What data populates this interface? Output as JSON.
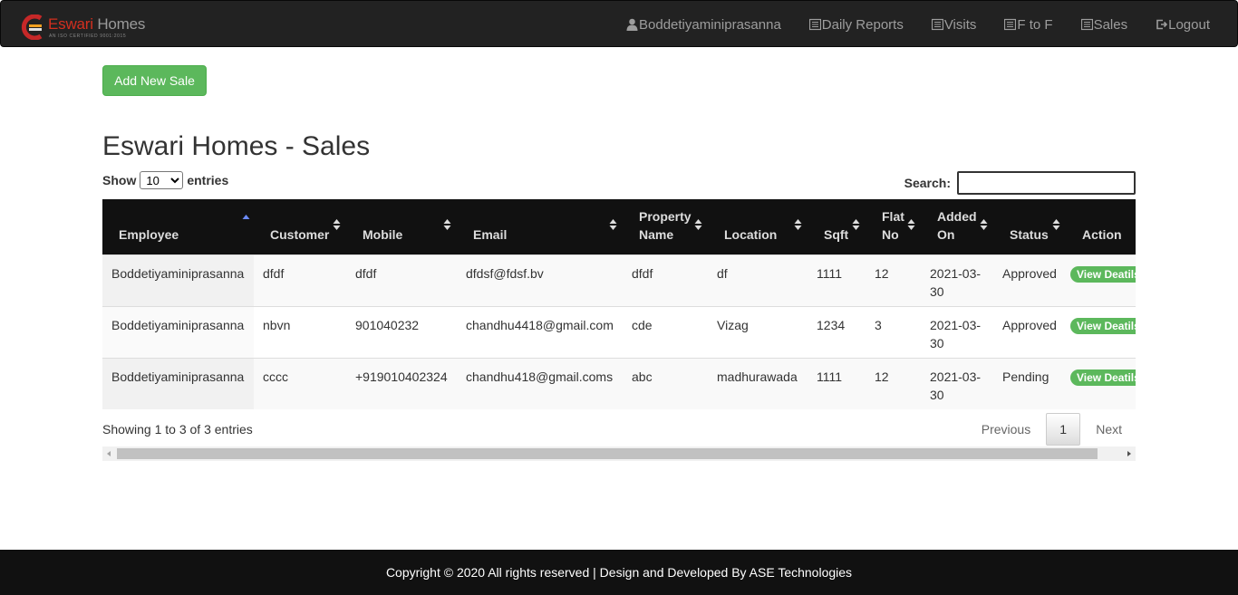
{
  "brand": {
    "name_part1": "Eswari",
    "name_part2": "Homes",
    "tagline": "AN ISO CERTIFIED 9001:2015",
    "accent_color": "#d32f1f"
  },
  "nav": [
    {
      "label": "Boddetiyaminiprasanna",
      "icon": "user-icon"
    },
    {
      "label": "Daily Reports",
      "icon": "list-icon"
    },
    {
      "label": "Visits",
      "icon": "list-icon"
    },
    {
      "label": "F to F",
      "icon": "list-icon"
    },
    {
      "label": "Sales",
      "icon": "list-icon"
    },
    {
      "label": "Logout",
      "icon": "logout-icon"
    }
  ],
  "actions": {
    "add_label": "Add New Sale"
  },
  "page_title": "Eswari Homes - Sales",
  "length": {
    "show": "Show",
    "value": "10",
    "entries": "entries"
  },
  "search": {
    "label": "Search:",
    "value": ""
  },
  "table": {
    "columns": [
      {
        "label": "Employee",
        "sort": "asc"
      },
      {
        "label": "Customer",
        "sort": "both"
      },
      {
        "label": "Mobile",
        "sort": "both"
      },
      {
        "label": "Email",
        "sort": "both"
      },
      {
        "label": "Property Name",
        "sort": "both"
      },
      {
        "label": "Location",
        "sort": "both"
      },
      {
        "label": "Sqft",
        "sort": "both"
      },
      {
        "label": "Flat No",
        "sort": "both"
      },
      {
        "label": "Added On",
        "sort": "both"
      },
      {
        "label": "Status",
        "sort": "both"
      },
      {
        "label": "Action",
        "sort": "none"
      }
    ],
    "rows": [
      [
        "Boddetiyaminiprasanna",
        "dfdf",
        "dfdf",
        "dfdsf@fdsf.bv",
        "dfdf",
        "df",
        "1111",
        "12",
        "2021-03-30",
        "Approved",
        "View Deatils"
      ],
      [
        "Boddetiyaminiprasanna",
        "nbvn",
        "901040232",
        "chandhu4418@gmail.com",
        "cde",
        "Vizag",
        "1234",
        "3",
        "2021-03-30",
        "Approved",
        "View Deatils"
      ],
      [
        "Boddetiyaminiprasanna",
        "cccc",
        "+919010402324",
        "chandhu418@gmail.coms",
        "abc",
        "madhurawada",
        "1111",
        "12",
        "2021-03-30",
        "Pending",
        "View Deatils"
      ]
    ]
  },
  "info": "Showing 1 to 3 of 3 entries",
  "pagination": {
    "previous": "Previous",
    "current": "1",
    "next": "Next"
  },
  "footer": "Copyright © 2020 All rights reserved | Design and Developed By ASE Technologies",
  "colors": {
    "navbar": "#222222",
    "success": "#5cb85c",
    "footer": "#111111"
  }
}
